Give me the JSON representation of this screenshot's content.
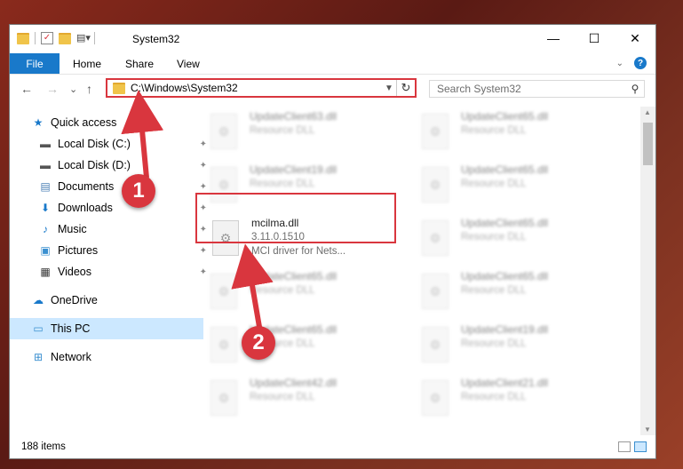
{
  "titlebar": {
    "title": "System32",
    "qat_icons": [
      "folder-icon",
      "properties-icon",
      "new-folder-icon",
      "customize-icon"
    ]
  },
  "window_controls": {
    "minimize": "—",
    "maximize": "☐",
    "close": "✕"
  },
  "ribbon": {
    "file": "File",
    "tabs": [
      "Home",
      "Share",
      "View"
    ]
  },
  "nav": {
    "back": "←",
    "forward": "→",
    "up_history": "⌄",
    "up": "↑",
    "address": "C:\\Windows\\System32",
    "refresh": "↻",
    "search_placeholder": "Search System32",
    "search_icon": "⚲"
  },
  "sidebar": {
    "items": [
      {
        "label": "Quick access",
        "icon": "star-icon",
        "glyph": "★",
        "color": "#1979ca",
        "pinned": false
      },
      {
        "label": "Local Disk (C:)",
        "icon": "drive-icon",
        "glyph": "▬",
        "color": "#555555",
        "pinned": true
      },
      {
        "label": "Local Disk (D:)",
        "icon": "drive-icon",
        "glyph": "▬",
        "color": "#555555",
        "pinned": true
      },
      {
        "label": "Documents",
        "icon": "documents-icon",
        "glyph": "▤",
        "color": "#4a7fb5",
        "pinned": true
      },
      {
        "label": "Downloads",
        "icon": "downloads-icon",
        "glyph": "⬇",
        "color": "#1979ca",
        "pinned": true
      },
      {
        "label": "Music",
        "icon": "music-icon",
        "glyph": "♪",
        "color": "#1979ca",
        "pinned": true
      },
      {
        "label": "Pictures",
        "icon": "pictures-icon",
        "glyph": "▣",
        "color": "#3a8fd0",
        "pinned": true
      },
      {
        "label": "Videos",
        "icon": "videos-icon",
        "glyph": "▦",
        "color": "#333333",
        "pinned": true
      },
      {
        "label": "OneDrive",
        "icon": "onedrive-icon",
        "glyph": "☁",
        "color": "#1979ca",
        "pinned": false
      },
      {
        "label": "This PC",
        "icon": "computer-icon",
        "glyph": "▭",
        "color": "#3a8fd0",
        "pinned": false
      },
      {
        "label": "Network",
        "icon": "network-icon",
        "glyph": "⊞",
        "color": "#3a8fd0",
        "pinned": false
      }
    ],
    "pin_glyph": "📌"
  },
  "files": {
    "highlighted": {
      "name": "mcilma.dll",
      "version": "3.11.0.1510",
      "description": "MCI driver for Nets..."
    },
    "blurred_left": [
      {
        "name": "UpdateClient63.dll",
        "type": "Resource DLL"
      },
      {
        "name": "UpdateClient19.dll",
        "type": "Resource DLL"
      },
      {
        "name": "UpdateClient65.dll",
        "type": "Resource DLL"
      },
      {
        "name": "UpdateClient65.dll",
        "type": "Resource DLL"
      },
      {
        "name": "UpdateClient42.dll",
        "type": "Resource DLL"
      }
    ],
    "blurred_right": [
      {
        "name": "UpdateClient65.dll",
        "type": "Resource DLL"
      },
      {
        "name": "UpdateClient65.dll",
        "type": "Resource DLL"
      },
      {
        "name": "UpdateClient65.dll",
        "type": "Resource DLL"
      },
      {
        "name": "UpdateClient65.dll",
        "type": "Resource DLL"
      },
      {
        "name": "UpdateClient19.dll",
        "type": "Resource DLL"
      },
      {
        "name": "UpdateClient21.dll",
        "type": "Resource DLL"
      }
    ]
  },
  "status": {
    "item_count": "188 items"
  },
  "annotations": {
    "step1": "1",
    "step2": "2",
    "color": "#d9363e"
  }
}
